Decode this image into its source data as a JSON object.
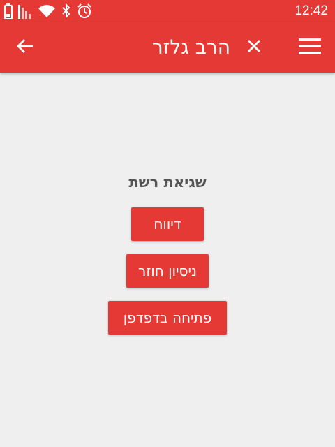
{
  "status_bar": {
    "time": "12:42",
    "icons": [
      "battery-icon",
      "signal-icon",
      "wifi-icon",
      "bluetooth-icon",
      "alarm-icon"
    ]
  },
  "app_bar": {
    "title": "הרב גלזר",
    "back_icon": "arrow-left-icon",
    "close_icon": "close-icon",
    "menu_icon": "hamburger-menu-icon"
  },
  "error": {
    "title": "שגיאת רשת",
    "report_label": "דיווח",
    "retry_label": "ניסיון חוזר",
    "open_browser_label": "פתיחה בדפדפן"
  },
  "colors": {
    "primary": "#e53935",
    "background": "#efefef",
    "error_text": "#555555"
  }
}
